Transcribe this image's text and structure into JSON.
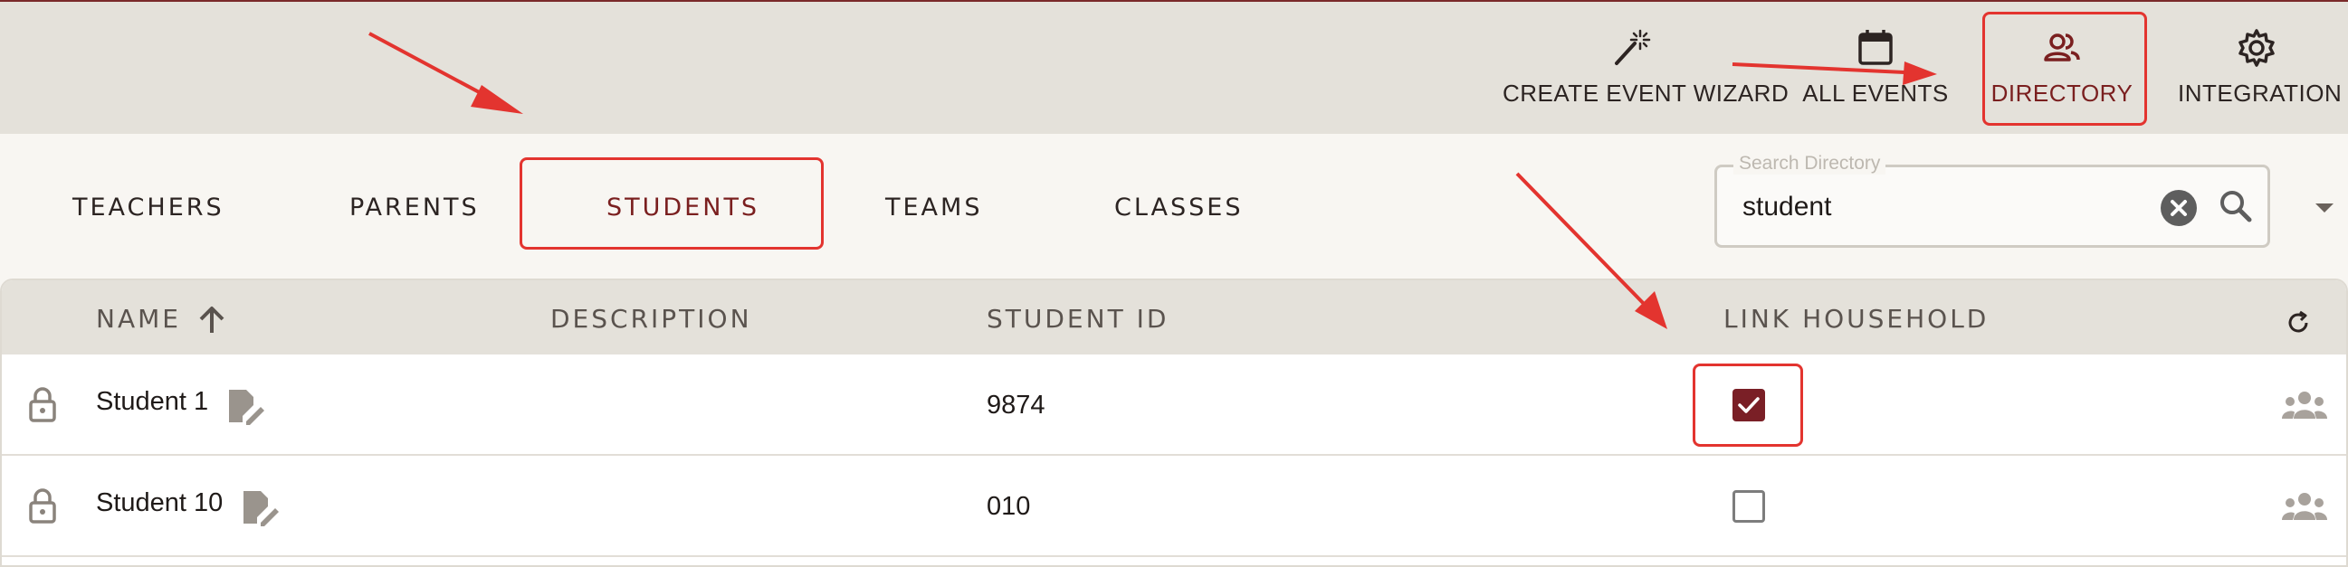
{
  "nav": {
    "items": [
      {
        "label": "CREATE EVENT WIZARD",
        "icon": "magic-wand-icon"
      },
      {
        "label": "ALL EVENTS",
        "icon": "calendar-icon"
      },
      {
        "label": "DIRECTORY",
        "icon": "people-icon"
      },
      {
        "label": "INTEGRATION",
        "icon": "gear-icon"
      }
    ],
    "active_item": "DIRECTORY"
  },
  "tabs": {
    "items": [
      {
        "label": "TEACHERS"
      },
      {
        "label": "PARENTS"
      },
      {
        "label": "STUDENTS"
      },
      {
        "label": "TEAMS"
      },
      {
        "label": "CLASSES"
      }
    ],
    "active_tab": "STUDENTS"
  },
  "search": {
    "label": "Search Directory",
    "value": "student"
  },
  "table": {
    "columns": {
      "name": "NAME",
      "description": "DESCRIPTION",
      "student_id": "STUDENT ID",
      "link_household": "LINK HOUSEHOLD"
    },
    "sort": {
      "column": "NAME",
      "direction": "ascending"
    },
    "rows": [
      {
        "name": "Student 1",
        "description": "",
        "student_id": "9874",
        "link_household": true
      },
      {
        "name": "Student 10",
        "description": "",
        "student_id": "010",
        "link_household": false
      }
    ]
  },
  "colors": {
    "accent": "#7a1f1f",
    "highlight": "#e3342f",
    "header_bg": "#e4e1da"
  }
}
